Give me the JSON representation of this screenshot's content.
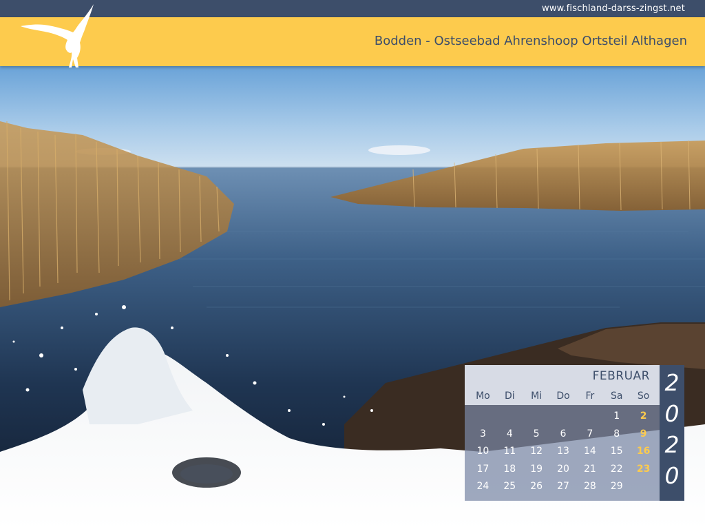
{
  "site_url": "www.fischland-darss-zingst.net",
  "header_title": "Bodden - Ostseebad Ahrenshoop Ortsteil Althagen",
  "logo_icon": "seagull-icon",
  "colors": {
    "top_bar": "#3d4e6a",
    "header": "#fdcb4d",
    "sunday": "#fdcb4d"
  },
  "calendar": {
    "month": "FEBRUAR",
    "weekdays": [
      "Mo",
      "Di",
      "Mi",
      "Do",
      "Fr",
      "Sa",
      "So"
    ],
    "first_weekday_index": 5,
    "days": [
      "1",
      "2",
      "3",
      "4",
      "5",
      "6",
      "7",
      "8",
      "9",
      "10",
      "11",
      "12",
      "13",
      "14",
      "15",
      "16",
      "17",
      "18",
      "19",
      "20",
      "21",
      "22",
      "23",
      "24",
      "25",
      "26",
      "27",
      "28",
      "29"
    ],
    "year_digits": [
      "2",
      "0",
      "2",
      "0"
    ]
  }
}
